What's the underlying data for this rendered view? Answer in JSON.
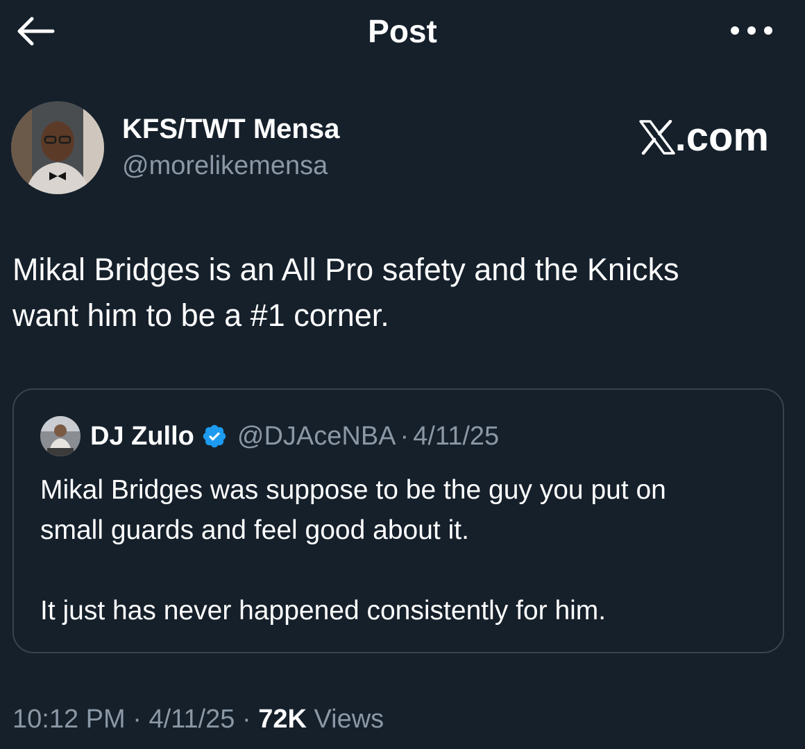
{
  "header": {
    "title": "Post",
    "back_icon": "arrow-left-icon",
    "more_icon": "more-dots-icon"
  },
  "author": {
    "name": "KFS/TWT Mensa",
    "handle": "@morelikemensa"
  },
  "watermark": {
    "logo": "x-logo",
    "suffix": ".com"
  },
  "post": {
    "text": "Mikal Bridges is an All Pro safety and the Knicks\nwant him to be a #1 corner."
  },
  "quote": {
    "name": "DJ Zullo",
    "verified": true,
    "handle": "@DJAceNBA",
    "separator": "·",
    "date": "4/11/25",
    "text": "Mikal Bridges was suppose to be the guy you put on\nsmall guards and feel good about it.\n\nIt just has never happened consistently for him."
  },
  "meta": {
    "time": "10:12 PM",
    "separator": "·",
    "date": "4/11/25",
    "views_count": "72K",
    "views_label": "Views"
  },
  "colors": {
    "background": "#15202b",
    "secondary_text": "#8b98a5",
    "border": "#38444d",
    "verified_badge": "#1d9bf0"
  }
}
